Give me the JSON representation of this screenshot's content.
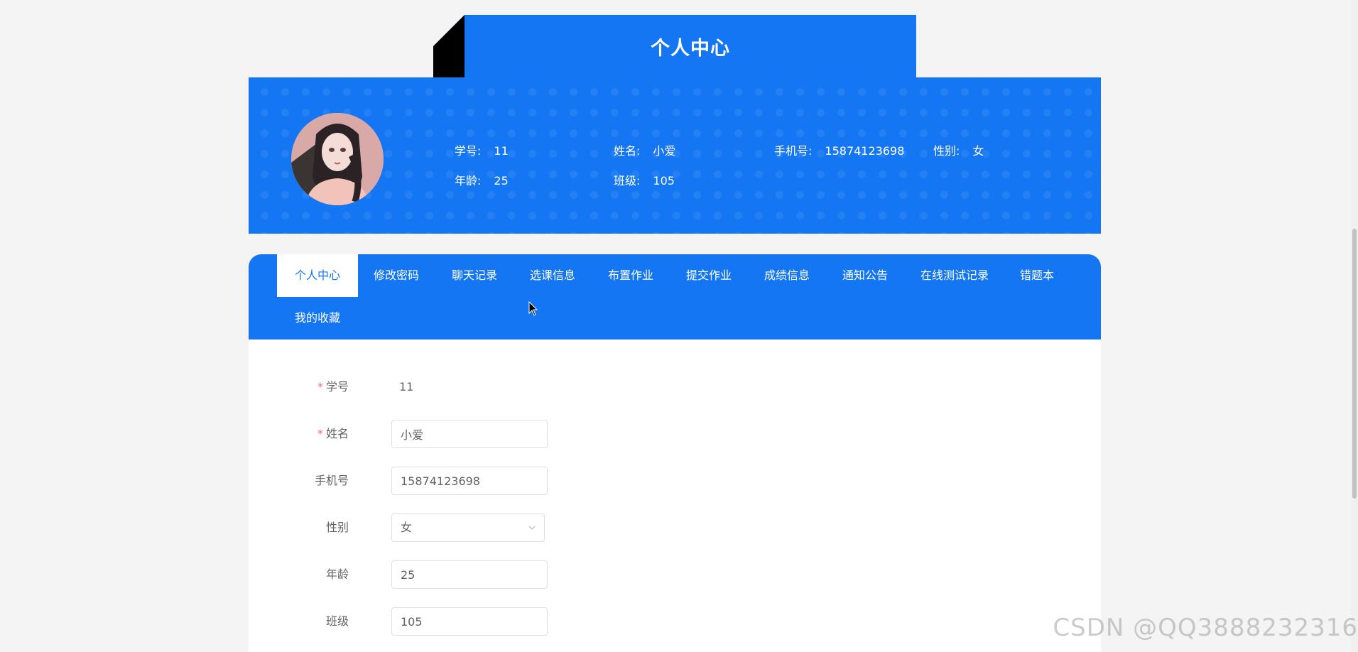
{
  "page": {
    "title": "个人中心"
  },
  "profile": {
    "fields": [
      {
        "label": "学号:",
        "value": "11"
      },
      {
        "label": "姓名:",
        "value": "小爱"
      },
      {
        "label": "手机号:",
        "value": "15874123698"
      },
      {
        "label": "性别:",
        "value": "女"
      },
      {
        "label": "年龄:",
        "value": "25"
      },
      {
        "label": "班级:",
        "value": "105"
      }
    ]
  },
  "tabs": [
    {
      "label": "个人中心",
      "active": true
    },
    {
      "label": "修改密码"
    },
    {
      "label": "聊天记录"
    },
    {
      "label": "选课信息"
    },
    {
      "label": "布置作业"
    },
    {
      "label": "提交作业"
    },
    {
      "label": "成绩信息"
    },
    {
      "label": "通知公告"
    },
    {
      "label": "在线测试记录"
    },
    {
      "label": "错题本"
    },
    {
      "label": "我的收藏"
    }
  ],
  "form": {
    "student_id": {
      "label": "学号",
      "required": true,
      "value": "11"
    },
    "name": {
      "label": "姓名",
      "required": true,
      "value": "小爱"
    },
    "phone": {
      "label": "手机号",
      "value": "15874123698"
    },
    "gender": {
      "label": "性别",
      "value": "女"
    },
    "age": {
      "label": "年龄",
      "value": "25"
    },
    "class": {
      "label": "班级",
      "value": "105"
    }
  },
  "watermark": "CSDN @QQ3888232316",
  "colors": {
    "primary": "#1476f2",
    "required": "#f56c6c",
    "text": "#606266"
  },
  "icons": [
    "chevron-down-icon",
    "mouse-cursor-icon"
  ]
}
